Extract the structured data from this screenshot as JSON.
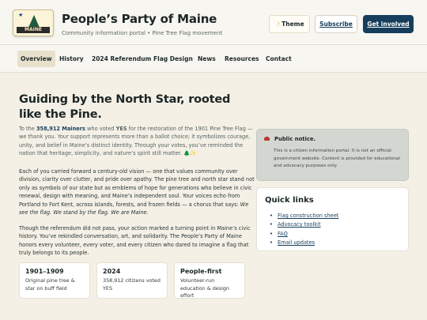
{
  "header": {
    "logo_text": "MAINE",
    "title": "People’s Party of Maine",
    "subtitle": "Community information portal • Pine Tree Flag movement",
    "theme_icon": "moon-icon",
    "theme_label": "Theme",
    "subscribe_label": "Subscribe",
    "join_label": "Get involved"
  },
  "nav": {
    "items": [
      {
        "label": "Overview",
        "active": true
      },
      {
        "label": "History"
      },
      {
        "label": "2024 Referendum"
      },
      {
        "label": "Flag Design"
      },
      {
        "label": "News"
      },
      {
        "label": "Resources"
      },
      {
        "label": "Contact"
      }
    ]
  },
  "main": {
    "title": "Guiding by the North Star, rooted like the Pine.",
    "intro": {
      "pre": "To the ",
      "count": "358,912 Mainers",
      "mid": " who voted ",
      "yes": "YES",
      "post": " for the restoration of the 1901 Pine Tree Flag — we thank you. Your support represents more than a ballot choice; it symbolizes courage, unity, and belief in Maine’s distinct identity. Through your votes, you’ve reminded the nation that heritage, simplicity, and nature’s spirit still matter. 🌲✨"
    },
    "para2": {
      "text": "Each of you carried forward a century-old vision — one that values community over division, clarity over clutter, and pride over apathy. The pine tree and north star stand not only as symbols of our state but as emblems of hope for generations who believe in civic renewal, design with meaning, and Maine’s independent soul. Your voices echo from Portland to Fort Kent, across islands, forests, and frozen fields — a chorus that says: ",
      "quote": "We see the flag. We stand by the flag. We are Maine."
    },
    "para3": "Though the referendum did not pass, your action marked a turning point in Maine’s civic history. You’ve rekindled conversation, art, and solidarity. The People’s Party of Maine honors every volunteer, every voter, and every citizen who dared to imagine a flag that truly belongs to its people.",
    "cards": [
      {
        "title": "1901–1909",
        "text": "Original pine tree & star on buff field"
      },
      {
        "title": "2024",
        "text": "358,912 citizens voted YES"
      },
      {
        "title": "People-first",
        "text": "Volunteer-run education & design effort"
      }
    ]
  },
  "sidebar": {
    "notice": {
      "title": "Public notice.",
      "text": "This is a citizen information portal. It is not an official government website. Content is provided for educational and advocacy purposes only."
    },
    "quick_links": {
      "title": "Quick links",
      "items": [
        "Flag construction sheet",
        "Advocacy toolkit",
        "FAQ",
        "Email updates"
      ]
    }
  }
}
